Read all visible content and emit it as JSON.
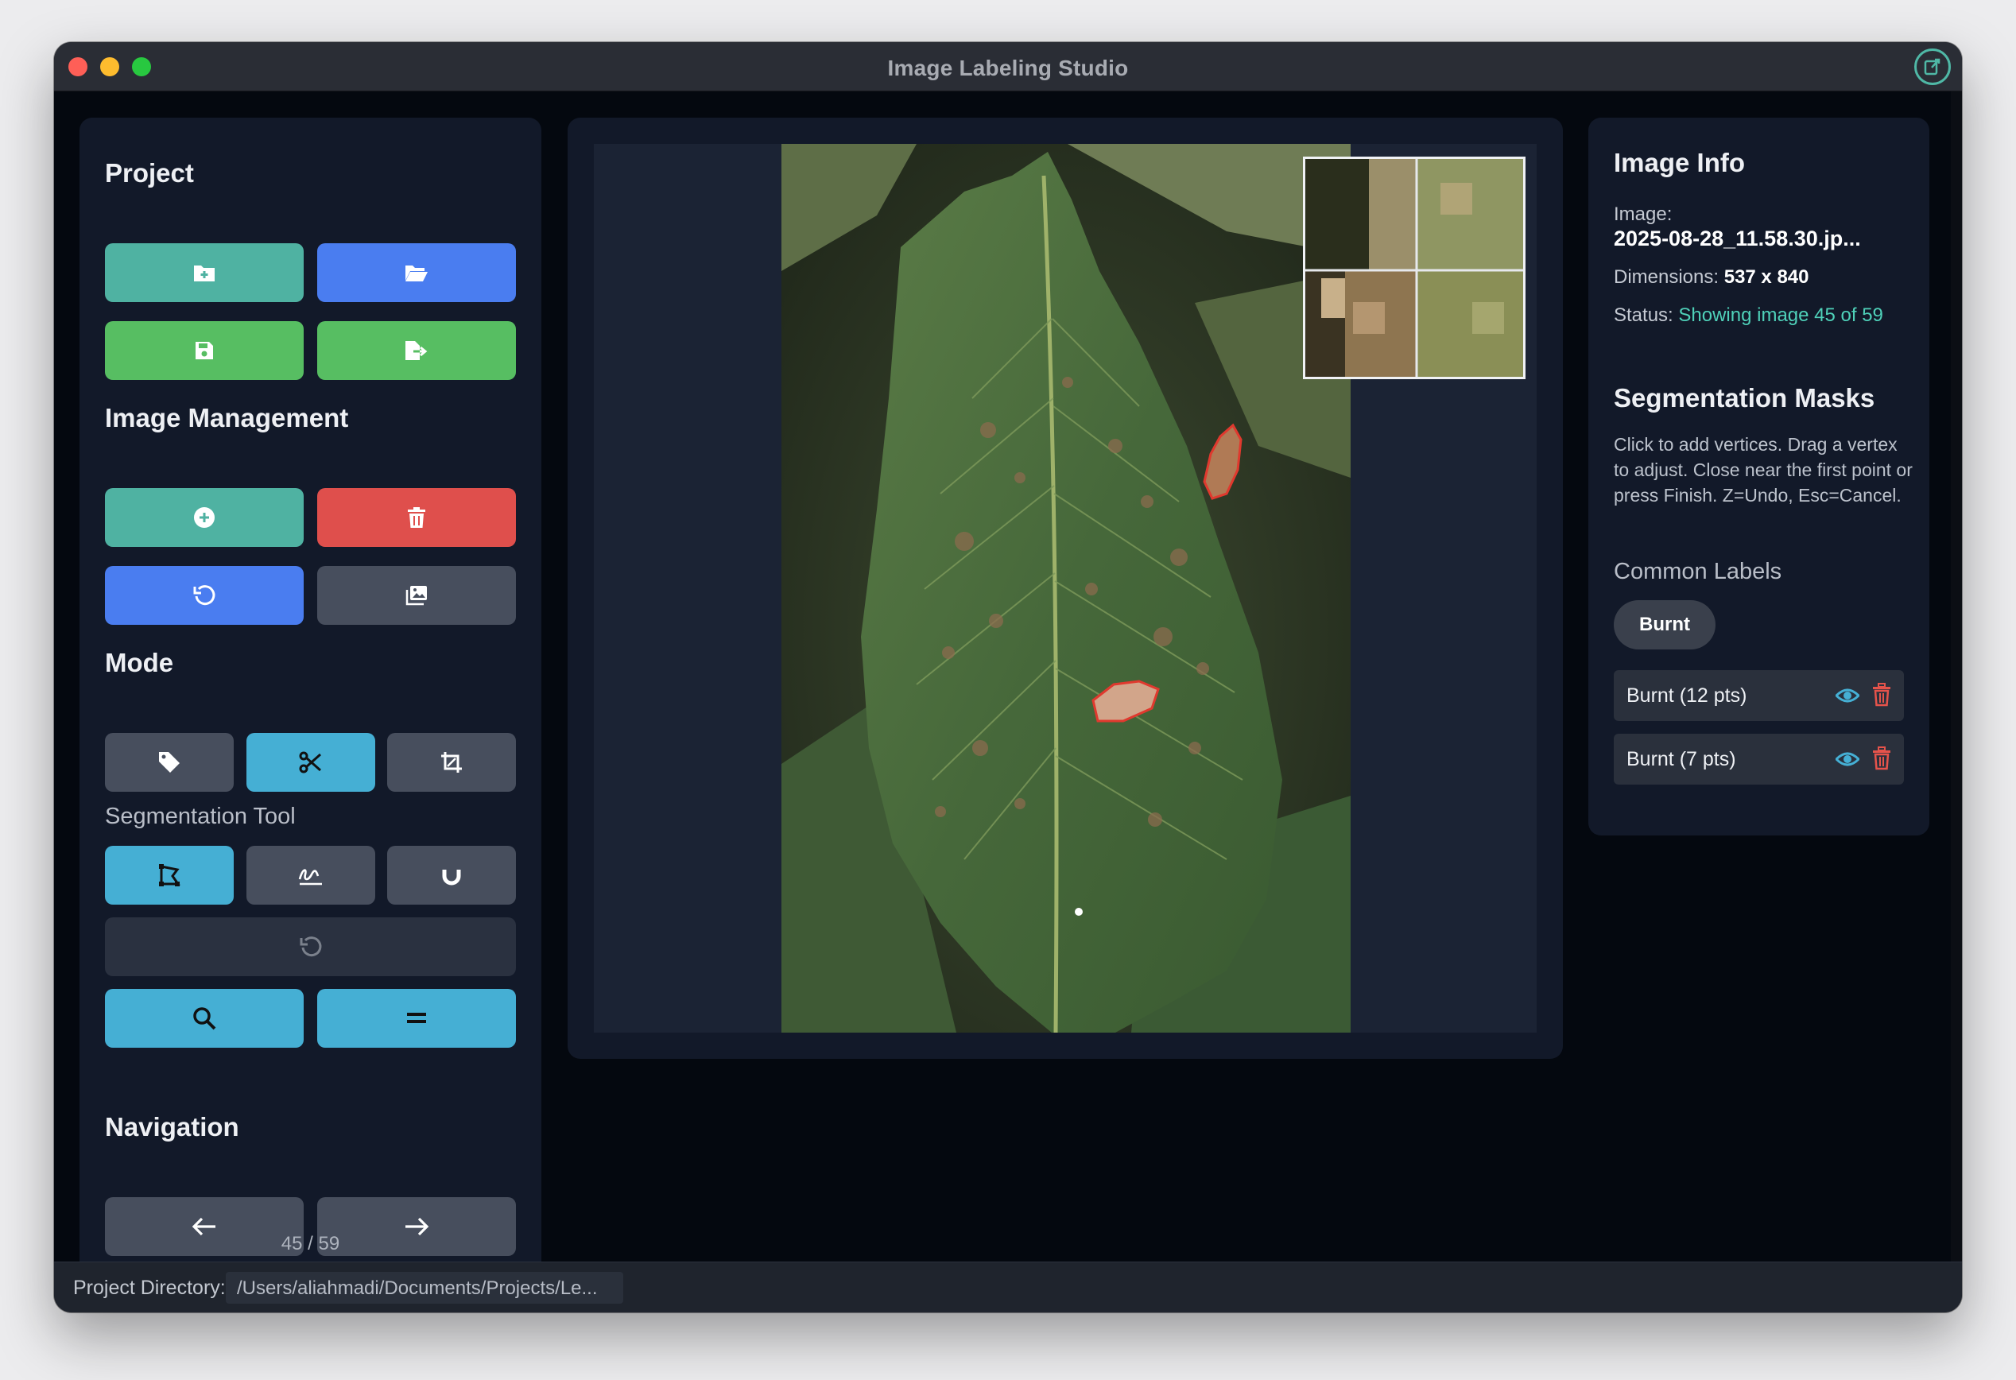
{
  "window": {
    "title": "Image Labeling Studio"
  },
  "sidebar": {
    "project_title": "Project",
    "project_buttons": [
      {
        "icon": "new-project-icon",
        "color": "#4fb2a2"
      },
      {
        "icon": "open-folder-icon",
        "color": "#4a7df0"
      },
      {
        "icon": "save-icon",
        "color": "#57be62"
      },
      {
        "icon": "export-icon",
        "color": "#57be62"
      }
    ],
    "image_management_title": "Image Management",
    "image_buttons": [
      {
        "icon": "add-image-icon",
        "color": "#4fb2a2"
      },
      {
        "icon": "trash-icon",
        "color": "#df4f4c"
      },
      {
        "icon": "reset-icon",
        "color": "#4a7df0"
      },
      {
        "icon": "gallery-icon",
        "color": "#474e5d"
      }
    ],
    "mode_title": "Mode",
    "mode_buttons": [
      {
        "icon": "tag-icon",
        "active": false
      },
      {
        "icon": "scissors-icon",
        "active": true
      },
      {
        "icon": "crop-icon",
        "active": false
      }
    ],
    "segmentation_tool_title": "Segmentation Tool",
    "segmentation_tools": [
      {
        "icon": "polygon-icon",
        "active": true
      },
      {
        "icon": "freehand-icon",
        "active": false
      },
      {
        "icon": "magnet-icon",
        "active": false
      }
    ],
    "navigation_title": "Navigation",
    "nav_count": "45 / 59"
  },
  "image_info": {
    "title": "Image Info",
    "image_label": "Image:",
    "image_name": "2025-08-28_11.58.30.jp...",
    "dimensions_label": "Dimensions:",
    "dimensions_value": "537 x 840",
    "status_label": "Status:",
    "status_value": "Showing image 45 of 59"
  },
  "segmentation_masks": {
    "title": "Segmentation Masks",
    "help": "Click to add vertices. Drag a vertex to adjust. Close near the first point or press Finish. Z=Undo, Esc=Cancel.",
    "common_labels_title": "Common Labels",
    "common_labels": [
      "Burnt"
    ],
    "masks": [
      {
        "label": "Burnt (12 pts)"
      },
      {
        "label": "Burnt (7 pts)"
      }
    ]
  },
  "statusbar": {
    "label": "Project Directory:",
    "path": "/Users/aliahmadi/Documents/Projects/Le..."
  },
  "colors": {
    "accent_teal": "#4fd1b9",
    "mask_outline": "#e0392e",
    "active_tool": "#45afd4"
  }
}
